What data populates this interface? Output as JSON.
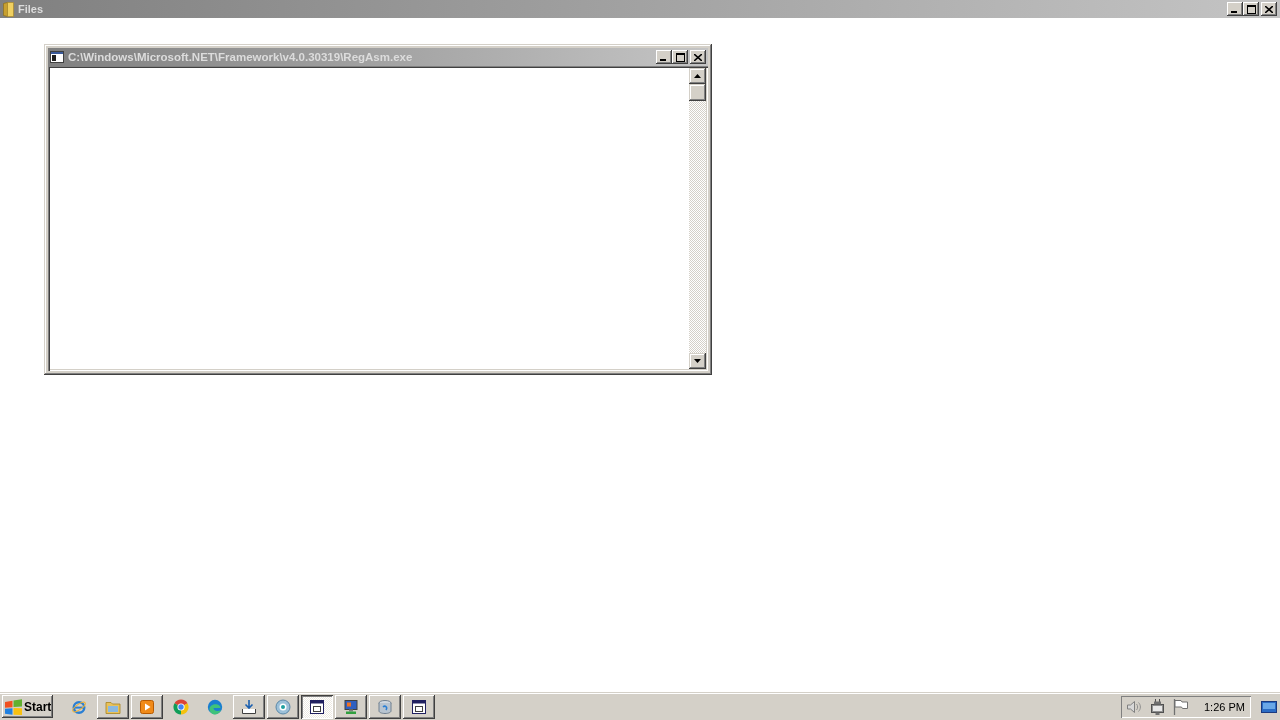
{
  "window": {
    "title": "Files",
    "active": false
  },
  "console_window": {
    "title": "C:\\Windows\\Microsoft.NET\\Framework\\v4.0.30319\\RegAsm.exe",
    "active": false
  },
  "taskbar": {
    "start": "Start",
    "buttons": [
      {
        "kind": "orbit",
        "open": false,
        "selected": false
      },
      {
        "kind": "folder",
        "open": true,
        "selected": false
      },
      {
        "kind": "play",
        "open": true,
        "selected": false
      },
      {
        "kind": "wheel",
        "open": false,
        "selected": false
      },
      {
        "kind": "swirl",
        "open": false,
        "selected": false
      },
      {
        "kind": "download",
        "open": true,
        "selected": false
      },
      {
        "kind": "disc",
        "open": true,
        "selected": false
      },
      {
        "kind": "window",
        "open": true,
        "selected": true
      },
      {
        "kind": "computer",
        "open": true,
        "selected": false
      },
      {
        "kind": "drive",
        "open": true,
        "selected": false
      },
      {
        "kind": "window",
        "open": true,
        "selected": false
      }
    ],
    "tray": {
      "time": "1:26 PM"
    }
  }
}
